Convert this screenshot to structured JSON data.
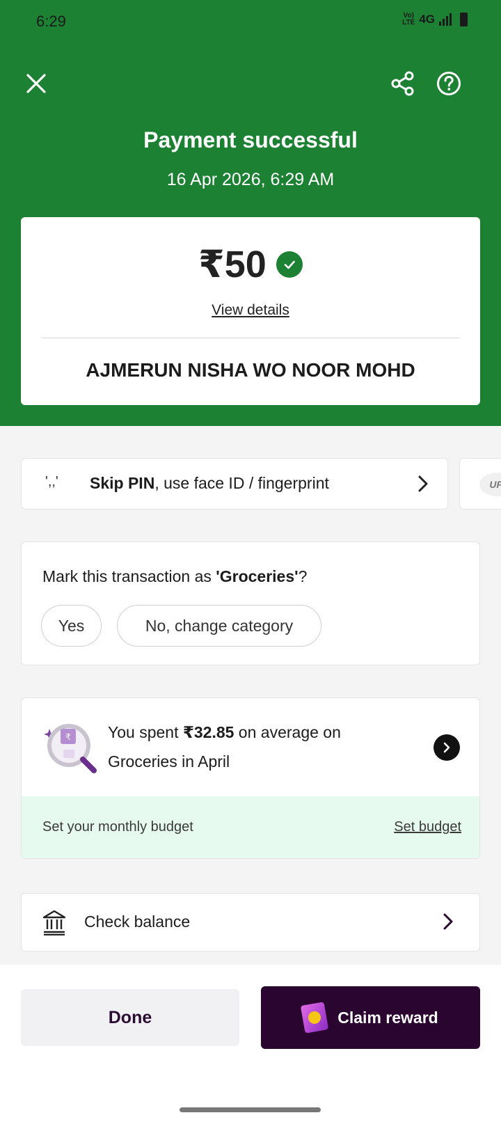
{
  "status_bar": {
    "time": "6:29",
    "network": "4G",
    "volte": "Vo LTE"
  },
  "header": {
    "title": "Payment successful",
    "datetime": "16 Apr 2026, 6:29 AM",
    "background_color": "#1d8134"
  },
  "payment": {
    "amount": "₹50",
    "view_details_label": "View details",
    "payee_name": "AJMERUN NISHA WO NOOR MOHD"
  },
  "skip_pin": {
    "bold_text": "Skip PIN",
    "rest_text": ", use face ID / fingerprint"
  },
  "upi_lite": {
    "logo_text": "UPI"
  },
  "category": {
    "question_prefix": "Mark this transaction as ",
    "category_name": "'Groceries'",
    "question_suffix": "?",
    "yes_label": "Yes",
    "change_label": "No, change category"
  },
  "spending": {
    "prefix": "You spent ",
    "amount": "₹32.85",
    "suffix": " on average on Groceries in April",
    "budget_label": "Set your monthly budget",
    "budget_link": "Set budget"
  },
  "balance": {
    "label": "Check balance"
  },
  "actions": {
    "done_label": "Done",
    "claim_label": "Claim reward",
    "claim_bg_color": "#2a0530"
  }
}
